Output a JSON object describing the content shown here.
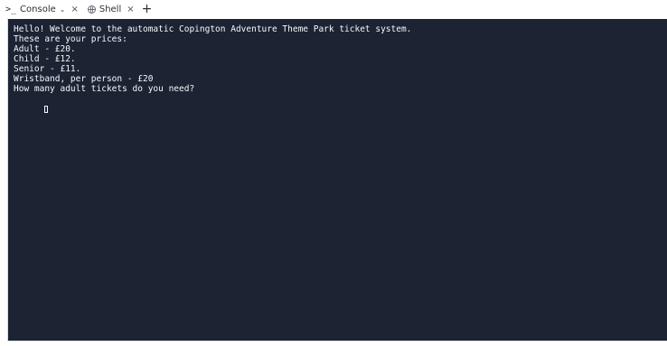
{
  "tabs": [
    {
      "prefix": ">_",
      "label": "Console",
      "has_dropdown": true,
      "close": "×",
      "active": true
    },
    {
      "label": "Shell",
      "close": "×",
      "active": false
    }
  ],
  "add_tab": "+",
  "terminal": {
    "lines": [
      "Hello! Welcome to the automatic Copington Adventure Theme Park ticket system.",
      "These are your prices:",
      "Adult - £20.",
      "Child - £12.",
      "Senior - £11.",
      "Wristband, per person - £20",
      "How many adult tickets do you need?"
    ]
  },
  "colors": {
    "terminal_bg": "#1c2333",
    "terminal_text": "#f5f9fc"
  },
  "icons": {
    "console": "terminal-prompt-icon",
    "shell": "shell-globe-icon",
    "dropdown": "chevron-down-icon",
    "close": "close-icon",
    "add": "plus-icon"
  }
}
